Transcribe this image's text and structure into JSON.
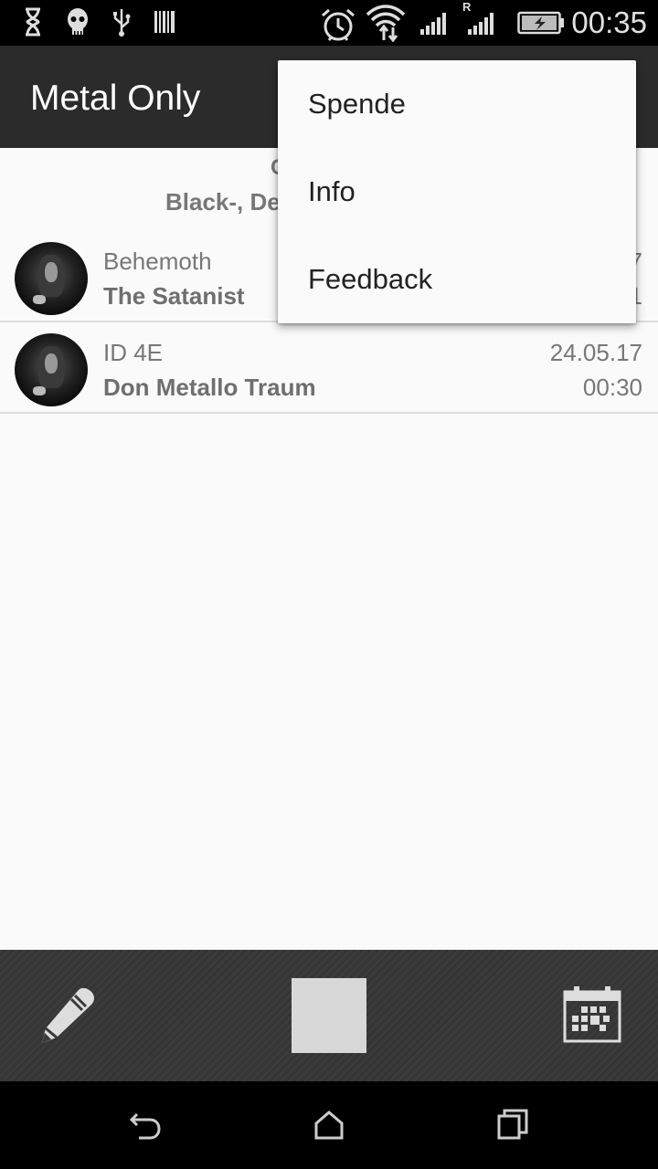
{
  "status_bar": {
    "time": "00:35",
    "icons": [
      "hourglass-icon",
      "skull-icon",
      "usb-icon",
      "barcode-icon",
      "alarm-icon",
      "wifi-icon",
      "signal-icon",
      "roaming-signal-icon",
      "battery-charging-icon"
    ],
    "roaming_indicator": "R"
  },
  "action_bar": {
    "title": "Metal Only"
  },
  "content": {
    "header": {
      "line1": "C",
      "line2": "Black-, De"
    },
    "rows": [
      {
        "artist": "Behemoth",
        "track": "The Satanist",
        "date": "7",
        "time": "1"
      },
      {
        "artist": "ID 4E",
        "track": "Don Metallo Traum",
        "date": "24.05.17",
        "time": "00:30"
      }
    ]
  },
  "overflow_menu": {
    "items": [
      {
        "label": "Spende"
      },
      {
        "label": "Info"
      },
      {
        "label": "Feedback"
      }
    ]
  },
  "bottom_bar": {
    "icons": [
      "pencil-icon",
      "play-stop-button",
      "calendar-icon"
    ]
  },
  "nav_bar": {
    "icons": [
      "back-icon",
      "home-icon",
      "recents-icon"
    ]
  }
}
